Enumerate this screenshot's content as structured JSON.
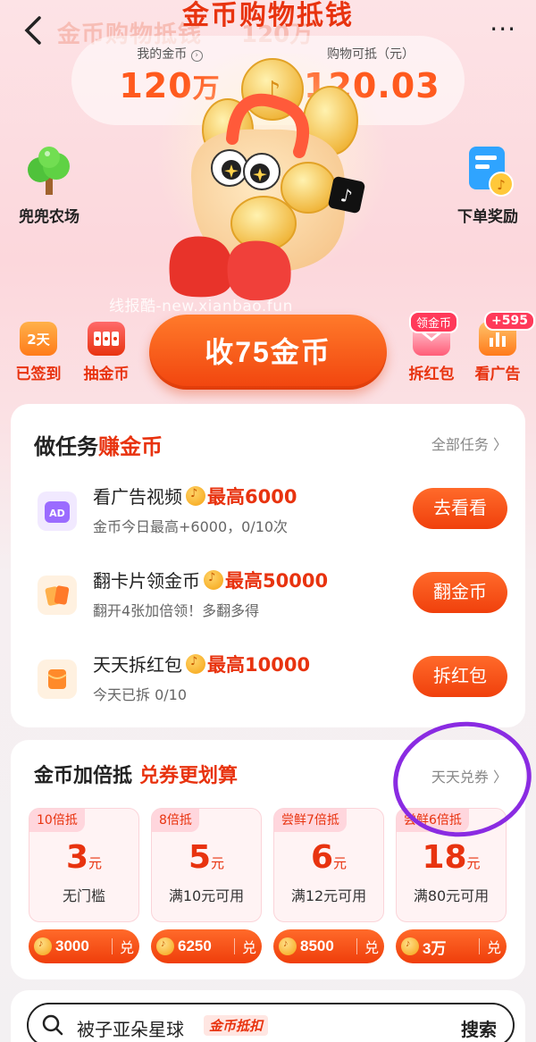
{
  "header": {
    "title": "金币购物抵钱",
    "ghost_title": "金币购物抵钱",
    "ghost_value": "120万",
    "more_label": "···",
    "coins_label": "我的金币",
    "coins_value": "120",
    "coins_unit": "万",
    "deduct_label": "购物可抵（元）",
    "deduct_value": "120.03"
  },
  "shortcuts": {
    "farm": "兜兜农场",
    "order_reward": "下单奖励",
    "signed": "已签到",
    "signed_icon": "2天",
    "draw": "抽金币",
    "redpack": "拆红包",
    "redpack_tag": "领金币",
    "watch_ad": "看广告",
    "watch_ad_tag": "+595"
  },
  "watermark": "线报酷-new.xianbao.fun",
  "collect_button": "收75金币",
  "tasks": {
    "title_part1": "做任务",
    "title_highlight": "赚金币",
    "all_link": "全部任务 〉",
    "items": [
      {
        "title": "看广告视频",
        "reward": "最高6000",
        "sub": "金币今日最高+6000，0/10次",
        "button": "去看看"
      },
      {
        "title": "翻卡片领金币",
        "reward": "最高50000",
        "sub": "翻开4张加倍领！多翻多得",
        "button": "翻金币"
      },
      {
        "title": "天天拆红包",
        "reward": "最高10000",
        "sub": "今天已拆 0/10",
        "button": "拆红包"
      }
    ]
  },
  "coupons": {
    "title": "金币加倍抵",
    "title_highlight": "兑券更划算",
    "link": "天天兑券 〉",
    "items": [
      {
        "tag": "10倍抵",
        "amount": "3",
        "unit": "元",
        "cond": "无门槛",
        "price": "3000",
        "redeem": "兑"
      },
      {
        "tag": "8倍抵",
        "amount": "5",
        "unit": "元",
        "cond": "满10元可用",
        "price": "6250",
        "redeem": "兑"
      },
      {
        "tag": "尝鲜7倍抵",
        "amount": "6",
        "unit": "元",
        "cond": "满12元可用",
        "price": "8500",
        "redeem": "兑"
      },
      {
        "tag": "尝鲜6倍抵",
        "amount": "18",
        "unit": "元",
        "cond": "满80元可用",
        "price": "3万",
        "redeem": "兑"
      }
    ]
  },
  "search": {
    "query": "被子亚朵星球",
    "tag": "金币抵扣",
    "button": "搜索"
  },
  "colors": {
    "accent": "#e8330f",
    "button_orange": "#f1440e",
    "annotation": "#8a2be2"
  }
}
